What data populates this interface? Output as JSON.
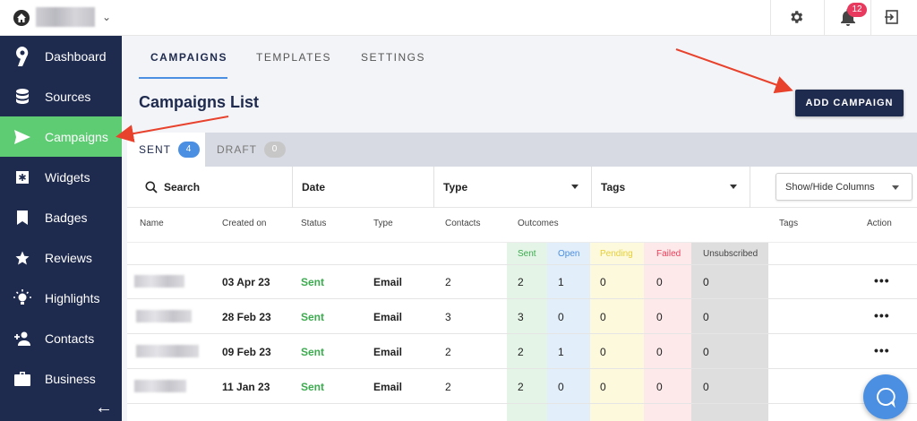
{
  "topbar": {
    "notification_count": "12"
  },
  "sidebar": {
    "items": [
      {
        "label": "Dashboard",
        "icon": "nine-logo-icon"
      },
      {
        "label": "Sources",
        "icon": "database-icon"
      },
      {
        "label": "Campaigns",
        "icon": "send-icon"
      },
      {
        "label": "Widgets",
        "icon": "widget-icon"
      },
      {
        "label": "Badges",
        "icon": "bookmark-icon"
      },
      {
        "label": "Reviews",
        "icon": "star-icon"
      },
      {
        "label": "Highlights",
        "icon": "lightbulb-icon"
      },
      {
        "label": "Contacts",
        "icon": "add-user-icon"
      },
      {
        "label": "Business",
        "icon": "briefcase-icon"
      }
    ],
    "active_index": 2,
    "active_color": "#5dcc73",
    "background_color": "#1e2a4e"
  },
  "main": {
    "tabs": [
      {
        "label": "CAMPAIGNS"
      },
      {
        "label": "TEMPLATES"
      },
      {
        "label": "SETTINGS"
      }
    ],
    "title": "Campaigns List",
    "add_button": "ADD CAMPAIGN",
    "subtabs": [
      {
        "label": "SENT",
        "count": "4"
      },
      {
        "label": "DRAFT",
        "count": "0"
      }
    ],
    "filters": {
      "search": "Search",
      "date": "Date",
      "type": "Type",
      "tags": "Tags",
      "show_hide": "Show/Hide Columns"
    },
    "table": {
      "headers": {
        "name": "Name",
        "created_on": "Created on",
        "status": "Status",
        "type": "Type",
        "contacts": "Contacts",
        "outcomes": "Outcomes",
        "tags": "Tags",
        "action": "Action"
      },
      "outcome_headers": {
        "sent": "Sent",
        "open": "Open",
        "pending": "Pending",
        "failed": "Failed",
        "unsubscribed": "Unsubscribed"
      },
      "rows": [
        {
          "created_on": "03 Apr 23",
          "status": "Sent",
          "type": "Email",
          "contacts": "2",
          "sent": "2",
          "open": "1",
          "pending": "0",
          "failed": "0",
          "unsubscribed": "0",
          "action": "•••"
        },
        {
          "created_on": "28 Feb 23",
          "status": "Sent",
          "type": "Email",
          "contacts": "3",
          "sent": "3",
          "open": "0",
          "pending": "0",
          "failed": "0",
          "unsubscribed": "0",
          "action": "•••"
        },
        {
          "created_on": "09 Feb 23",
          "status": "Sent",
          "type": "Email",
          "contacts": "2",
          "sent": "2",
          "open": "1",
          "pending": "0",
          "failed": "0",
          "unsubscribed": "0",
          "action": "•••"
        },
        {
          "created_on": "11 Jan 23",
          "status": "Sent",
          "type": "Email",
          "contacts": "2",
          "sent": "2",
          "open": "0",
          "pending": "0",
          "failed": "0",
          "unsubscribed": "0",
          "action": ""
        }
      ]
    }
  },
  "colors": {
    "navy": "#1e2a4e",
    "accent_blue": "#4a8fe2",
    "status_green": "#3bab4e",
    "annotation_red": "#e8412c",
    "outcome_sent": "#e4f4e6",
    "outcome_open": "#e3eefb",
    "outcome_pending": "#fdf9dc",
    "outcome_failed": "#fde8ea",
    "outcome_unsubscribed": "#dedede"
  }
}
